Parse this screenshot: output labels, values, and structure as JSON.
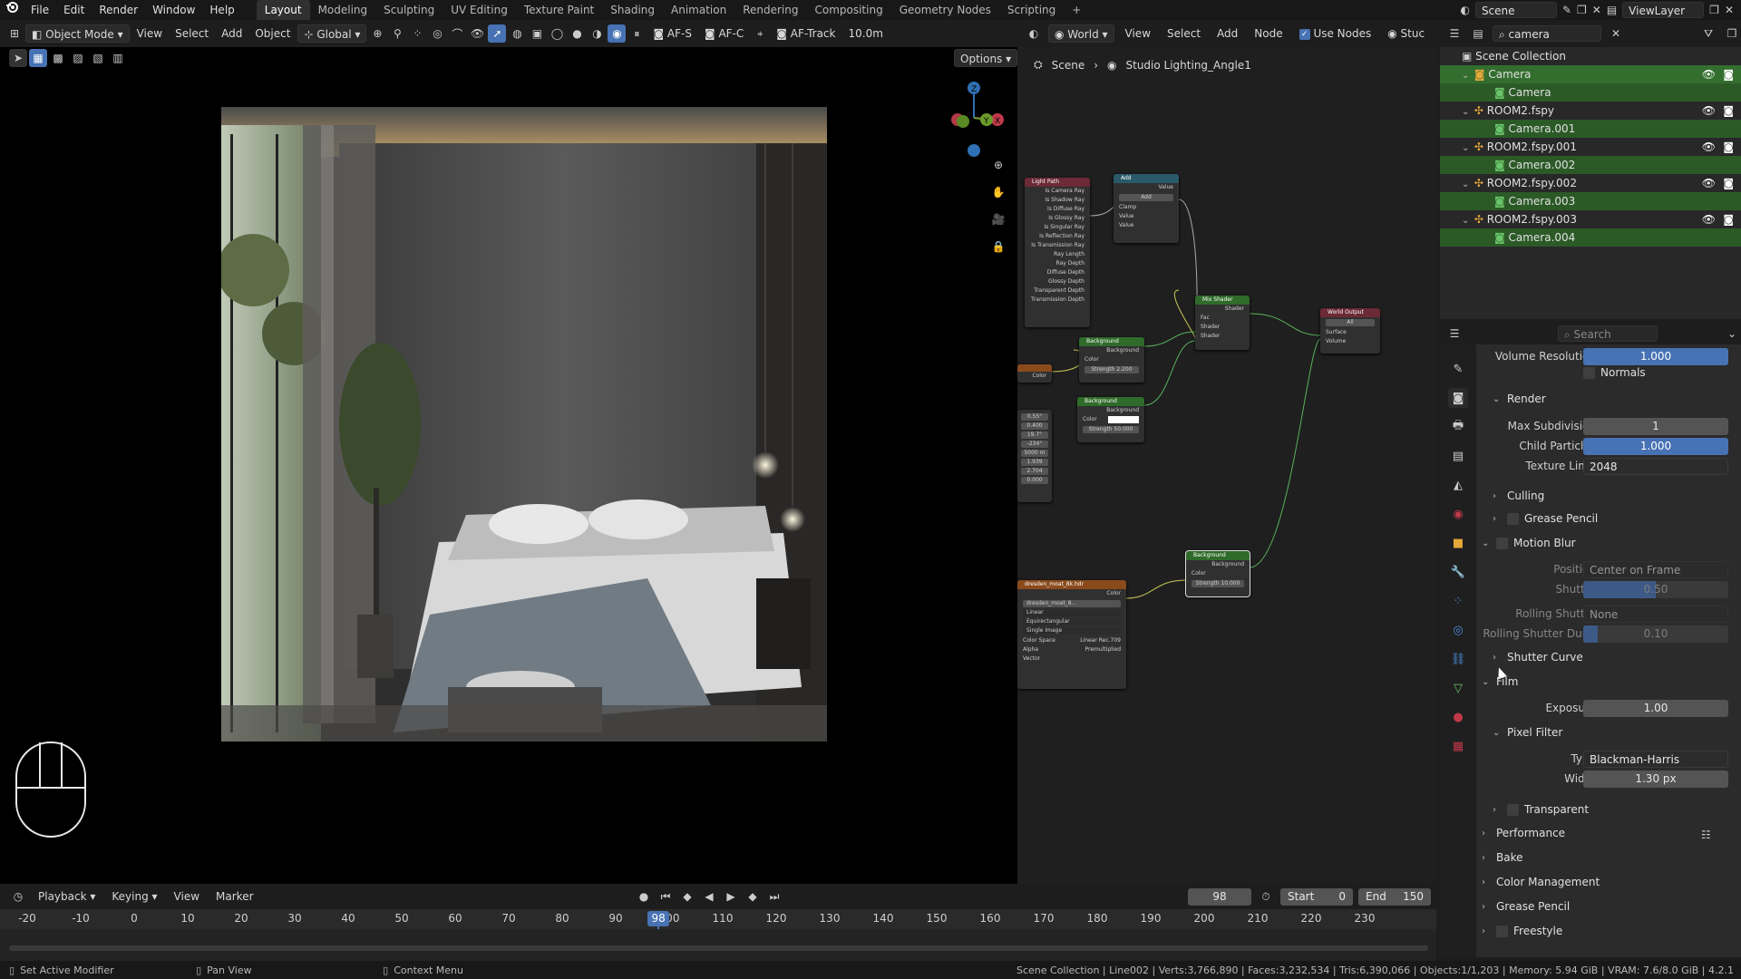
{
  "menu": {
    "file": "File",
    "edit": "Edit",
    "render": "Render",
    "window": "Window",
    "help": "Help"
  },
  "workspaces": [
    "Layout",
    "Modeling",
    "Sculpting",
    "UV Editing",
    "Texture Paint",
    "Shading",
    "Animation",
    "Rendering",
    "Compositing",
    "Geometry Nodes",
    "Scripting"
  ],
  "top_right": {
    "scene": "Scene",
    "view_layer": "ViewLayer"
  },
  "toolbar": {
    "mode": "Object Mode",
    "view": "View",
    "select": "Select",
    "add": "Add",
    "object": "Object",
    "orientation": "Global",
    "af_s": "AF-S",
    "af_c": "AF-C",
    "af_track": "AF-Track",
    "distance": "10.0m",
    "options": "Options"
  },
  "node_editor": {
    "world": "World",
    "view": "View",
    "select": "Select",
    "add": "Add",
    "node": "Node",
    "use_nodes": "Use Nodes",
    "stud": "Stuc"
  },
  "breadcrumb": {
    "scene": "Scene",
    "world": "Studio Lighting_Angle1"
  },
  "nodes": {
    "light_path": {
      "title": "Light Path",
      "outputs": [
        "Is Camera Ray",
        "Is Shadow Ray",
        "Is Diffuse Ray",
        "Is Glossy Ray",
        "Is Singular Ray",
        "Is Reflection Ray",
        "Is Transmission Ray",
        "Ray Length",
        "Ray Depth",
        "Diffuse Depth",
        "Glossy Depth",
        "Transparent Depth",
        "Transmission Depth"
      ]
    },
    "add": {
      "title": "Add",
      "value": "Value",
      "op": "Add",
      "clamp": "Clamp",
      "in1": "Value",
      "in2": "Value"
    },
    "mix": {
      "title": "Mix Shader",
      "shader": "Shader",
      "fac": "Fac",
      "s1": "Shader",
      "s2": "Shader"
    },
    "output": {
      "title": "World Output",
      "all": "All",
      "surface": "Surface",
      "volume": "Volume"
    },
    "bg1": {
      "title": "Background",
      "out": "Background",
      "color": "Color",
      "strength": "Strength 2.200"
    },
    "bg2": {
      "title": "Background",
      "out": "Background",
      "color": "Color",
      "strength": "Strength 50.000"
    },
    "bg3": {
      "title": "Background",
      "out": "Background",
      "color": "Color",
      "strength": "Strength 10.000"
    },
    "env": {
      "title": "dresden_moat_8k.hdr",
      "color": "Color",
      "file": "dresden_moat_8...",
      "linear": "Linear",
      "proj": "Equirectangular",
      "single": "Single Image",
      "space_label": "Color Space",
      "space": "Linear Rec.709",
      "alpha_label": "Alpha",
      "alpha": "Premultiplied",
      "vector": "Vector"
    },
    "mapping_vals": [
      "0.55°",
      "0.400",
      "19.7°",
      "-234°",
      "5000 m",
      "1.939",
      "2.704",
      "0.000"
    ]
  },
  "outliner": {
    "search": "camera",
    "root": "Scene Collection",
    "rows": [
      {
        "name": "Camera",
        "child": "Camera"
      },
      {
        "name": "ROOM2.fspy",
        "child": "Camera.001"
      },
      {
        "name": "ROOM2.fspy.001",
        "child": "Camera.002"
      },
      {
        "name": "ROOM2.fspy.002",
        "child": "Camera.003"
      },
      {
        "name": "ROOM2.fspy.003",
        "child": "Camera.004"
      }
    ]
  },
  "properties": {
    "search_placeholder": "Search",
    "volume_resolution": {
      "label": "Volume Resolution",
      "value": "1.000"
    },
    "normals": "Normals",
    "render": "Render",
    "max_subdivision": {
      "label": "Max Subdivision",
      "value": "1"
    },
    "child_particles": {
      "label": "Child Particles",
      "value": "1.000"
    },
    "texture_limit": {
      "label": "Texture Limit",
      "value": "2048"
    },
    "culling": "Culling",
    "grease_pencil_sub": "Grease Pencil",
    "motion_blur": "Motion Blur",
    "position": {
      "label": "Position",
      "value": "Center on Frame"
    },
    "shutter": {
      "label": "Shutter",
      "value": "0.50"
    },
    "rolling_shutter": {
      "label": "Rolling Shutter",
      "value": "None"
    },
    "rolling_dur": {
      "label": "Rolling Shutter Dur...",
      "value": "0.10"
    },
    "shutter_curve": "Shutter Curve",
    "film": "Film",
    "exposure": {
      "label": "Exposure",
      "value": "1.00"
    },
    "pixel_filter": "Pixel Filter",
    "type": {
      "label": "Type",
      "value": "Blackman-Harris"
    },
    "width": {
      "label": "Width",
      "value": "1.30 px"
    },
    "transparent": "Transparent",
    "performance": "Performance",
    "bake": "Bake",
    "color_management": "Color Management",
    "grease_pencil": "Grease Pencil",
    "freestyle": "Freestyle"
  },
  "timeline": {
    "playback": "Playback",
    "keying": "Keying",
    "view": "View",
    "marker": "Marker",
    "current_frame": "98",
    "start_label": "Start",
    "start": "0",
    "end_label": "End",
    "end": "150",
    "ticks": [
      "-20",
      "-10",
      "0",
      "10",
      "20",
      "30",
      "40",
      "50",
      "60",
      "70",
      "80",
      "90",
      "100",
      "110",
      "120",
      "130",
      "140",
      "150",
      "160",
      "170",
      "180",
      "190",
      "200",
      "210",
      "220",
      "230"
    ],
    "playhead": "98"
  },
  "status": {
    "left1": "Set Active Modifier",
    "left2": "Pan View",
    "left3": "Context Menu",
    "stats": "Scene Collection | Line002 | Verts:3,766,890 | Faces:3,232,534 | Tris:6,390,066 | Objects:1/1,203 | Memory: 5.94 GiB | VRAM: 7.6/8.0 GiB | 4.2.1"
  },
  "colors": {
    "accent": "#4772b3",
    "selected_green": "#336e2e",
    "node_green": "#2f6b2a",
    "node_red": "#6b2a36",
    "node_orange": "#8a4a1c",
    "node_teal": "#2a5a6a"
  }
}
